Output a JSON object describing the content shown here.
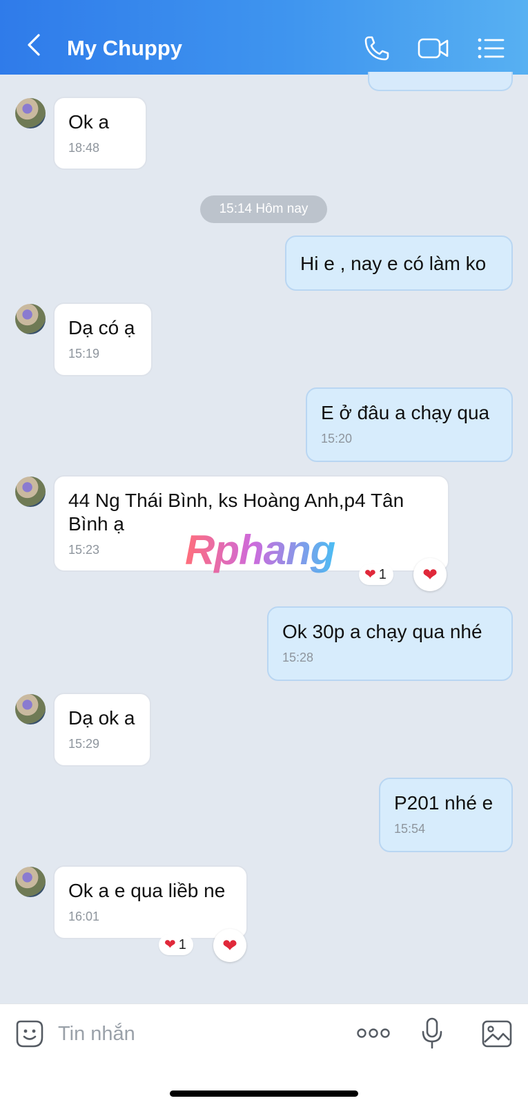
{
  "header": {
    "title": "My Chuppy"
  },
  "chat": {
    "date_separator": "15:14 Hôm nay",
    "messages": [
      {
        "from": "them",
        "text": "Ok a",
        "time": "18:48"
      },
      {
        "from": "me",
        "text": "Hi e , nay e có làm ko"
      },
      {
        "from": "them",
        "text": "Dạ có ạ",
        "time": "15:19"
      },
      {
        "from": "me",
        "text": "E ở đâu a chạy qua",
        "time": "15:20"
      },
      {
        "from": "them",
        "text": "44 Ng Thái Bình, ks Hoàng Anh,p4 Tân Bình ạ",
        "time": "15:23",
        "reaction_count": "1"
      },
      {
        "from": "me",
        "text": "Ok 30p a chạy qua nhé",
        "time": "15:28"
      },
      {
        "from": "them",
        "text": "Dạ ok a",
        "time": "15:29"
      },
      {
        "from": "me",
        "text": "P201 nhé e",
        "time": "15:54"
      },
      {
        "from": "them",
        "text": "Ok a e qua liềb ne",
        "time": "16:01",
        "reaction_count": "1"
      }
    ]
  },
  "watermark": "Rphang",
  "input": {
    "placeholder": "Tin nhắn"
  },
  "colors": {
    "header_start": "#2f7bea",
    "header_end": "#57b0f2",
    "chat_bg": "#e2e8f0",
    "outgoing_bubble": "#d7ecfc",
    "incoming_bubble": "#ffffff",
    "reaction_heart": "#e0283a"
  },
  "icons": {
    "back": "chevron-left-icon",
    "call": "phone-icon",
    "video": "video-camera-icon",
    "menu": "list-menu-icon",
    "sticker": "sticker-smiley-icon",
    "more": "more-dots-icon",
    "mic": "microphone-icon",
    "image": "image-icon",
    "reaction": "heart-icon"
  }
}
